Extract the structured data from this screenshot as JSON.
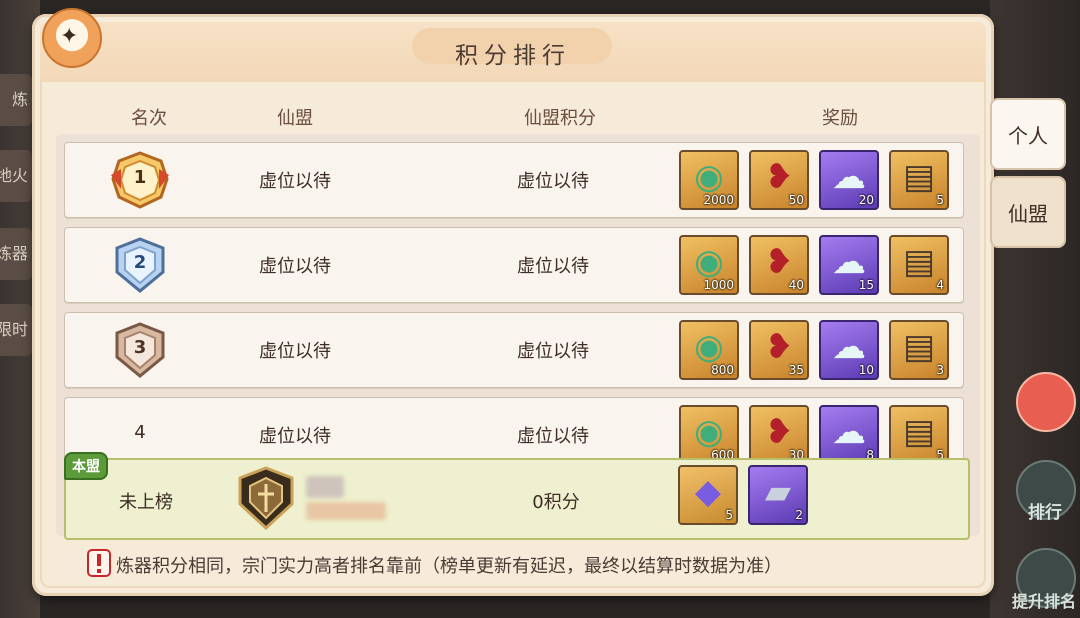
{
  "title": "积分排行",
  "columns": {
    "rank": "名次",
    "alliance": "仙盟",
    "score": "仙盟积分",
    "reward": "奖励"
  },
  "rows": [
    {
      "rank": "1",
      "alliance": "虚位以待",
      "score": "虚位以待",
      "rewards": [
        "2000",
        "50",
        "20",
        "5"
      ]
    },
    {
      "rank": "2",
      "alliance": "虚位以待",
      "score": "虚位以待",
      "rewards": [
        "1000",
        "40",
        "15",
        "4"
      ]
    },
    {
      "rank": "3",
      "alliance": "虚位以待",
      "score": "虚位以待",
      "rewards": [
        "800",
        "35",
        "10",
        "3"
      ]
    },
    {
      "rank": "4",
      "alliance": "虚位以待",
      "score": "虚位以待",
      "rewards": [
        "600",
        "30",
        "8",
        "5"
      ]
    }
  ],
  "reward_items": [
    "jade-icon",
    "red-feather-icon",
    "cloud-gourd-icon",
    "treasure-chest-icon"
  ],
  "own": {
    "tag": "本盟",
    "rank": "未上榜",
    "score": "0积分",
    "rewards": [
      "5",
      "2"
    ],
    "reward_items": [
      "crystal-icon",
      "ingot-icon"
    ]
  },
  "note": "炼器积分相同，宗门实力高者排名靠前（榜单更新有延迟，最终以结算时数据为准）",
  "tabs": [
    {
      "label": "个人",
      "active": true
    },
    {
      "label": "仙盟",
      "active": false
    }
  ],
  "background": {
    "left_tabs": [
      "炼",
      "地火",
      "炼器",
      "限时"
    ],
    "right_labels": [
      "排行",
      "提升排名"
    ]
  }
}
